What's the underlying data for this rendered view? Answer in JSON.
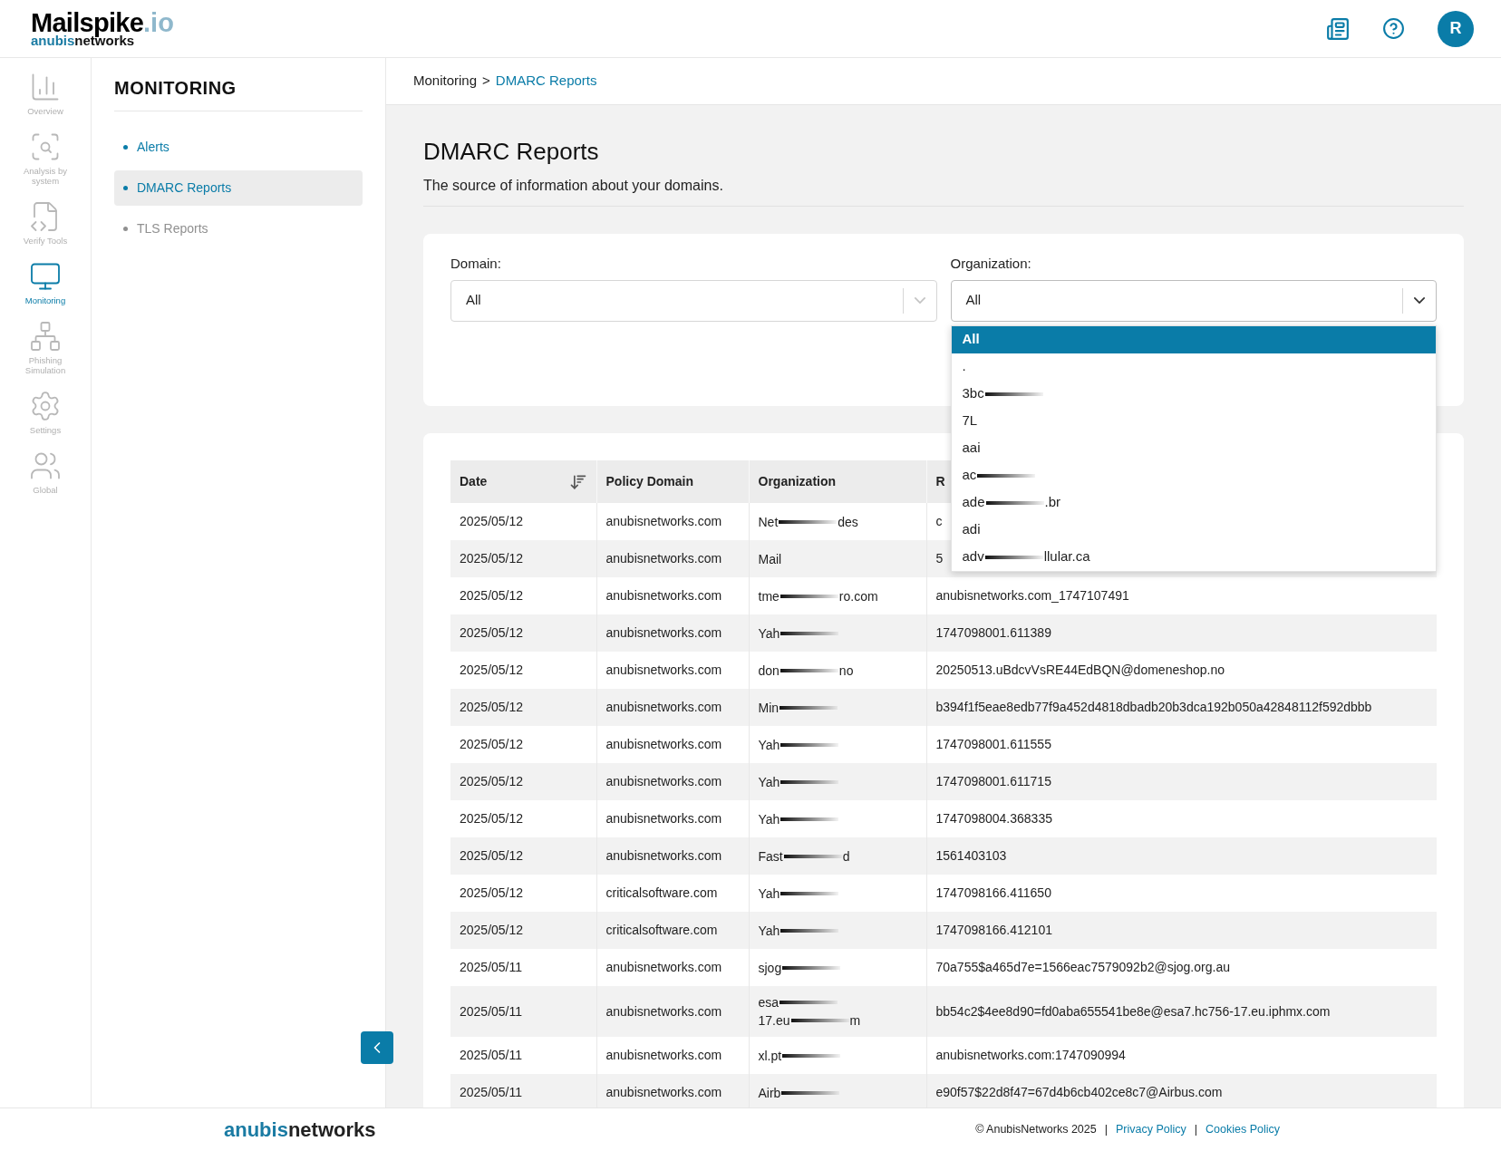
{
  "header": {
    "logo": {
      "name": "Mailspike",
      "suffix": ".io",
      "sub_a": "anubis",
      "sub_b": "networks"
    },
    "avatar": "R"
  },
  "rail": [
    {
      "label": "Overview",
      "selected": false
    },
    {
      "label": "Analysis by system",
      "selected": false
    },
    {
      "label": "Verify Tools",
      "selected": false
    },
    {
      "label": "Monitoring",
      "selected": true
    },
    {
      "label": "Phishing Simulation",
      "selected": false
    },
    {
      "label": "Settings",
      "selected": false
    },
    {
      "label": "Global",
      "selected": false
    }
  ],
  "submenu": {
    "title": "MONITORING",
    "items": [
      {
        "label": "Alerts",
        "selected": false,
        "disabled": false
      },
      {
        "label": "DMARC Reports",
        "selected": true,
        "disabled": false
      },
      {
        "label": "TLS Reports",
        "selected": false,
        "disabled": true
      }
    ]
  },
  "breadcrumb": [
    {
      "kind": "crumb",
      "text": "Monitoring",
      "selected": false
    },
    {
      "kind": "sep",
      "text": ">"
    },
    {
      "kind": "crumb",
      "text": "DMARC Reports",
      "selected": true
    }
  ],
  "page": {
    "title": "DMARC Reports",
    "subtitle": "The source of information about your domains."
  },
  "filters": [
    {
      "label": "Domain:",
      "value": "All",
      "open": false
    },
    {
      "label": "Organization:",
      "value": "All",
      "open": true,
      "options": [
        {
          "start": "All",
          "redacted": false,
          "selected": true
        },
        {
          "start": ".",
          "redacted": false,
          "selected": false
        },
        {
          "start": "3bc",
          "redacted": true,
          "selected": false
        },
        {
          "start": "7L",
          "redacted": false,
          "selected": false
        },
        {
          "start": "aai",
          "redacted": false,
          "selected": false
        },
        {
          "start": "ac",
          "redacted": true,
          "selected": false
        },
        {
          "start": "ade",
          "redacted": true,
          "end": ".br",
          "selected": false
        },
        {
          "start": "adi",
          "redacted": false,
          "selected": false
        },
        {
          "start": "adv",
          "redacted": true,
          "end": "llular.ca",
          "selected": false
        }
      ]
    }
  ],
  "table": {
    "columns": [
      {
        "label": "Date",
        "sorted": true
      },
      {
        "label": "Policy Domain",
        "sorted": false
      },
      {
        "label": "Organization",
        "sorted": false
      },
      {
        "label": "R",
        "sorted": false
      }
    ],
    "rows": [
      {
        "date": "2025/05/12",
        "policy_domain": "anubisnetworks.com",
        "organization": [
          {
            "start": "Net",
            "redacted": true,
            "end": "des"
          }
        ],
        "column_4": "c"
      },
      {
        "date": "2025/05/12",
        "policy_domain": "anubisnetworks.com",
        "organization": [
          {
            "start": "Mail",
            "redacted": false
          }
        ],
        "column_4": "5"
      },
      {
        "date": "2025/05/12",
        "policy_domain": "anubisnetworks.com",
        "organization": [
          {
            "start": "tme",
            "redacted": true,
            "end": "ro.com"
          }
        ],
        "column_4": "anubisnetworks.com_1747107491"
      },
      {
        "date": "2025/05/12",
        "policy_domain": "anubisnetworks.com",
        "organization": [
          {
            "start": "Yah",
            "redacted": true
          }
        ],
        "column_4": "1747098001.611389"
      },
      {
        "date": "2025/05/12",
        "policy_domain": "anubisnetworks.com",
        "organization": [
          {
            "start": "don",
            "redacted": true,
            "end": "no"
          }
        ],
        "column_4": "20250513.uBdcvVsRE44EdBQN@domeneshop.no"
      },
      {
        "date": "2025/05/12",
        "policy_domain": "anubisnetworks.com",
        "organization": [
          {
            "start": "Min",
            "redacted": true
          }
        ],
        "column_4": "b394f1f5eae8edb77f9a452d4818dbadb20b3dca192b050a42848112f592dbbb"
      },
      {
        "date": "2025/05/12",
        "policy_domain": "anubisnetworks.com",
        "organization": [
          {
            "start": "Yah",
            "redacted": true
          }
        ],
        "column_4": "1747098001.611555"
      },
      {
        "date": "2025/05/12",
        "policy_domain": "anubisnetworks.com",
        "organization": [
          {
            "start": "Yah",
            "redacted": true
          }
        ],
        "column_4": "1747098001.611715"
      },
      {
        "date": "2025/05/12",
        "policy_domain": "anubisnetworks.com",
        "organization": [
          {
            "start": "Yah",
            "redacted": true
          }
        ],
        "column_4": "1747098004.368335"
      },
      {
        "date": "2025/05/12",
        "policy_domain": "anubisnetworks.com",
        "organization": [
          {
            "start": "Fast",
            "redacted": true,
            "end": "d"
          }
        ],
        "column_4": "1561403103"
      },
      {
        "date": "2025/05/12",
        "policy_domain": "criticalsoftware.com",
        "organization": [
          {
            "start": "Yah",
            "redacted": true
          }
        ],
        "column_4": "1747098166.411650"
      },
      {
        "date": "2025/05/12",
        "policy_domain": "criticalsoftware.com",
        "organization": [
          {
            "start": "Yah",
            "redacted": true
          }
        ],
        "column_4": "1747098166.412101"
      },
      {
        "date": "2025/05/11",
        "policy_domain": "anubisnetworks.com",
        "organization": [
          {
            "start": "sjog",
            "redacted": true
          }
        ],
        "column_4": "70a755$a465d7e=1566eac7579092b2@sjog.org.au"
      },
      {
        "date": "2025/05/11",
        "policy_domain": "anubisnetworks.com",
        "organization": [
          {
            "start": "esa",
            "redacted": true
          },
          {
            "start": "17.eu",
            "redacted": true,
            "end": "m"
          }
        ],
        "column_4": "bb54c2$4ee8d90=fd0aba655541be8e@esa7.hc756-17.eu.iphmx.com"
      },
      {
        "date": "2025/05/11",
        "policy_domain": "anubisnetworks.com",
        "organization": [
          {
            "start": "xl.pt",
            "redacted": true
          }
        ],
        "column_4": "anubisnetworks.com:1747090994"
      },
      {
        "date": "2025/05/11",
        "policy_domain": "anubisnetworks.com",
        "organization": [
          {
            "start": "Airb",
            "redacted": true
          }
        ],
        "column_4": "e90f57$22d8f47=67d4b6cb402ce8c7@Airbus.com"
      }
    ]
  },
  "footer": {
    "logo_a": "anubis",
    "logo_b": "networks",
    "items": [
      {
        "kind": "text",
        "text": "© AnubisNetworks 2025"
      },
      {
        "kind": "sep",
        "text": "|"
      },
      {
        "kind": "link",
        "text": "Privacy Policy"
      },
      {
        "kind": "sep",
        "text": "|"
      },
      {
        "kind": "link",
        "text": "Cookies Policy"
      }
    ]
  }
}
